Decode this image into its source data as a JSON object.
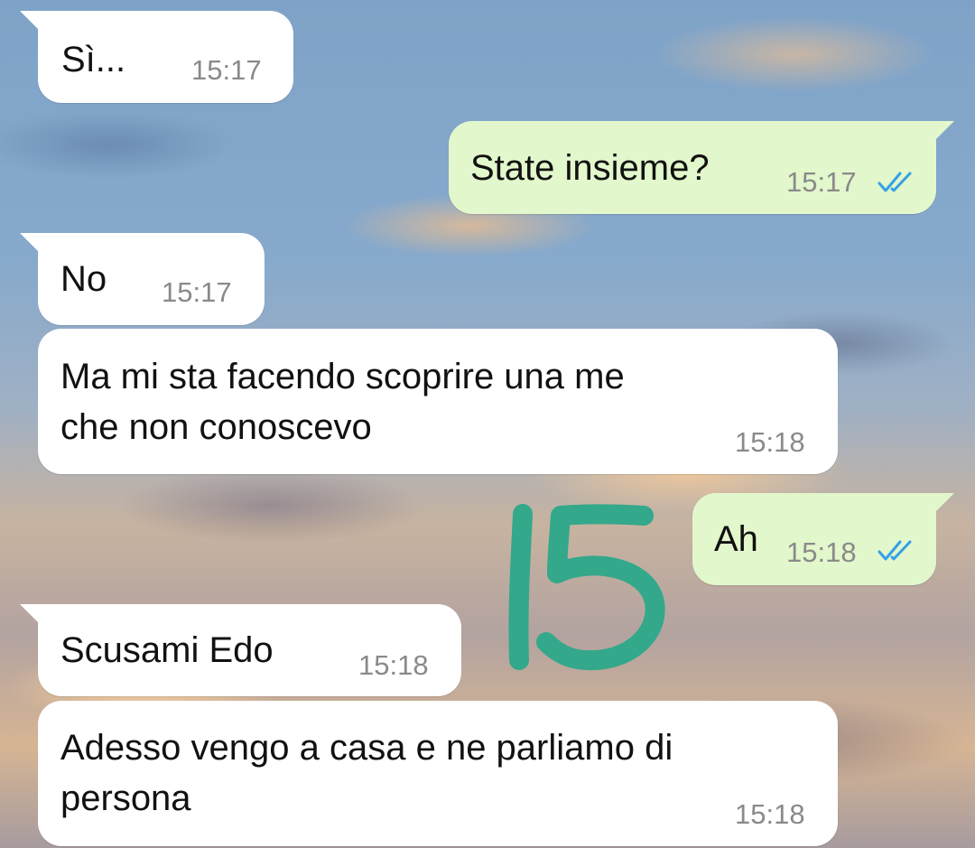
{
  "app": {
    "accent_in_bubble": "#ffffff",
    "accent_out_bubble": "#e2f7cb",
    "read_receipt_color": "#34a0e8",
    "overlay_color": "#33a88a"
  },
  "messages": [
    {
      "direction": "incoming",
      "text": "Sì...",
      "time": "15:17"
    },
    {
      "direction": "outgoing",
      "text": "State insieme?",
      "time": "15:17",
      "status": "read",
      "status_icon": "double-check-icon"
    },
    {
      "direction": "incoming",
      "text": "No",
      "time": "15:17"
    },
    {
      "direction": "incoming",
      "text": "Ma mi sta facendo scoprire una me\nche non conoscevo",
      "time": "15:18"
    },
    {
      "direction": "outgoing",
      "text": "Ah",
      "time": "15:18",
      "status": "read",
      "status_icon": "double-check-icon"
    },
    {
      "direction": "incoming",
      "text": "Scusami Edo",
      "time": "15:18"
    },
    {
      "direction": "incoming",
      "text": "Adesso vengo a casa e ne parliamo di\npersona",
      "time": "15:18"
    }
  ],
  "overlay": {
    "handwritten_number": "15"
  }
}
